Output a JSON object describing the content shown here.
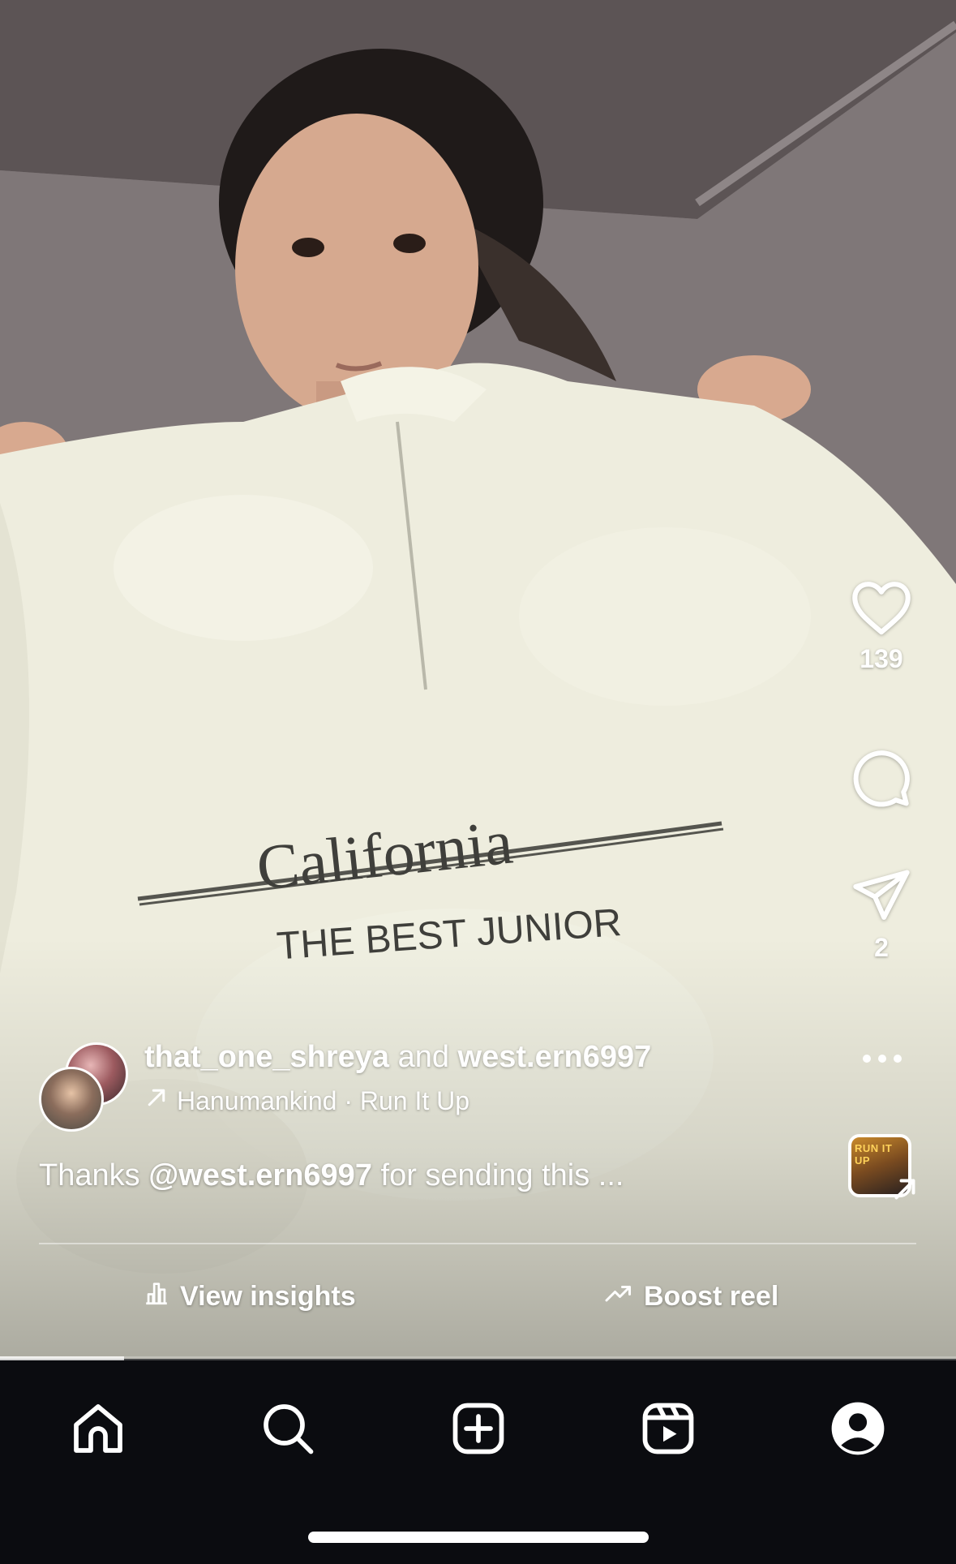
{
  "reel": {
    "likes_count": "139",
    "shares_count": "2",
    "collab": {
      "author": "that_one_shreya",
      "connector": "and",
      "collaborator": "west.ern6997"
    },
    "audio": {
      "text": "Hanumankind · Run It Up",
      "thumb_text": "RUN IT UP"
    },
    "caption": {
      "prefix": "Thanks",
      "mention": "@west.ern6997",
      "rest": "for sending this ..."
    },
    "progress": 0.13,
    "actions": {
      "insights_label": "View insights",
      "boost_label": "Boost reel"
    },
    "sweater_text": {
      "line1": "California",
      "line2": "THE BEST JUNIOR"
    }
  },
  "icons": {
    "like": "heart-icon",
    "comment": "comment-icon",
    "share": "paper-plane-icon",
    "more": "more-dots-icon",
    "audio": "trending-arrow-icon",
    "insights": "bar-chart-icon",
    "boost": "trending-up-icon"
  },
  "tabbar": {
    "tabs": [
      "home",
      "search",
      "create",
      "reels",
      "profile"
    ]
  },
  "colors": {
    "tabbar_bg": "#0b0c10",
    "text": "#ffffff"
  }
}
